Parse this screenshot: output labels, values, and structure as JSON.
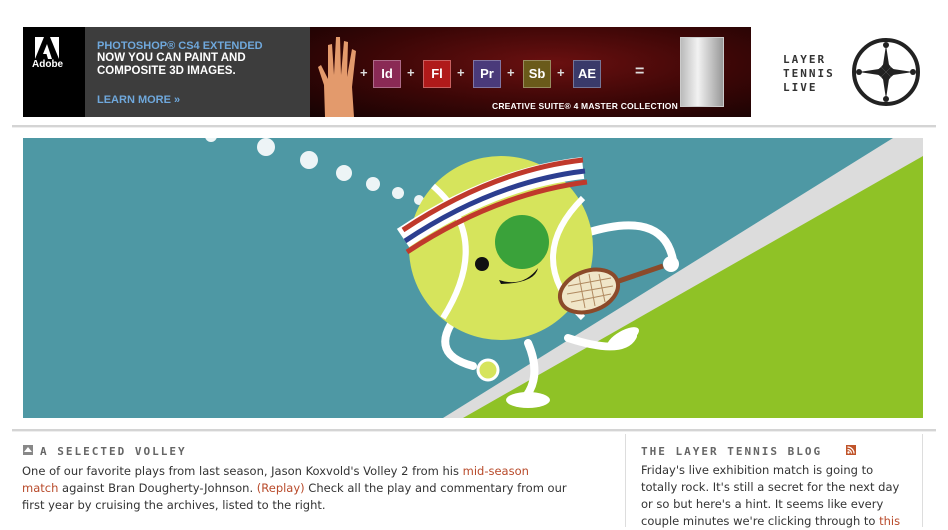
{
  "ad": {
    "brand": "Adobe",
    "product": "PHOTOSHOP® CS4 EXTENDED",
    "headline": "NOW YOU CAN PAINT AND COMPOSITE 3D IMAGES.",
    "cta": "LEARN MORE »",
    "suite_chips": [
      {
        "label": "Id",
        "color": "#8a2a55"
      },
      {
        "label": "Fl",
        "color": "#b01a1a"
      },
      {
        "label": "Pr",
        "color": "#4a3a7a"
      },
      {
        "label": "Sb",
        "color": "#6a5a1a"
      },
      {
        "label": "AE",
        "color": "#3a3a6a"
      }
    ],
    "suite_tagline": "CREATIVE SUITE® 4 MASTER COLLECTION"
  },
  "site": {
    "title_lines": [
      "LAYER",
      "TENNIS",
      "LIVE"
    ],
    "logo_icon": "compass-star-icon"
  },
  "hero": {
    "illustration": "tennis-ball-mascot",
    "colors": {
      "sky": "#4e98a4",
      "court": "#8fc226",
      "line": "#d8d8d8",
      "ball": "#d6e45c"
    }
  },
  "selected_volley": {
    "heading": "A SELECTED VOLLEY",
    "text_1": "One of our favorite plays from last season, Jason Koxvold's Volley 2 from his ",
    "link_match_1": "mid-season",
    "link_match_2": "match",
    "text_2": " against Bran Dougherty-Johnson. ",
    "link_replay": "(Replay)",
    "text_3": " Check all the play and commentary from our",
    "line_3": "first year by cruising the archives, listed to the right."
  },
  "blog": {
    "heading": "THE LAYER TENNIS BLOG",
    "lines": [
      "Friday's live exhibition match is going to",
      "totally rock. It's still a secret for the next day",
      "or so but here's a hint. It seems like every",
      "couple minutes we're clicking through to "
    ],
    "link": "this"
  }
}
